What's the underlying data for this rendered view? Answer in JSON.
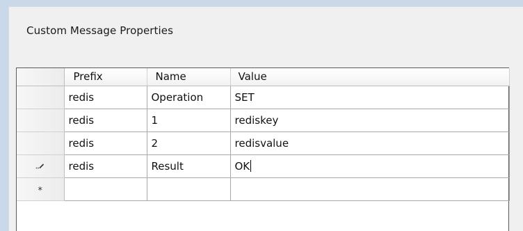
{
  "panel": {
    "title": "Custom Message Properties"
  },
  "grid": {
    "columns": [
      "Prefix",
      "Name",
      "Value"
    ],
    "rows": [
      {
        "prefix": "redis",
        "name": "Operation",
        "value": "SET",
        "indicator": ""
      },
      {
        "prefix": "redis",
        "name": "1",
        "value": "rediskey",
        "indicator": ""
      },
      {
        "prefix": "redis",
        "name": "2",
        "value": "redisvalue",
        "indicator": ""
      },
      {
        "prefix": "redis",
        "name": "Result",
        "value": "OK",
        "indicator": "pencil-icon"
      },
      {
        "prefix": "",
        "name": "",
        "value": "",
        "indicator": "star-icon"
      }
    ],
    "new_row_marker": "*"
  },
  "colors": {
    "window_border": "#c9d9ea",
    "panel_background": "#f0f0f0",
    "grid_line": "#a8a8a8"
  }
}
